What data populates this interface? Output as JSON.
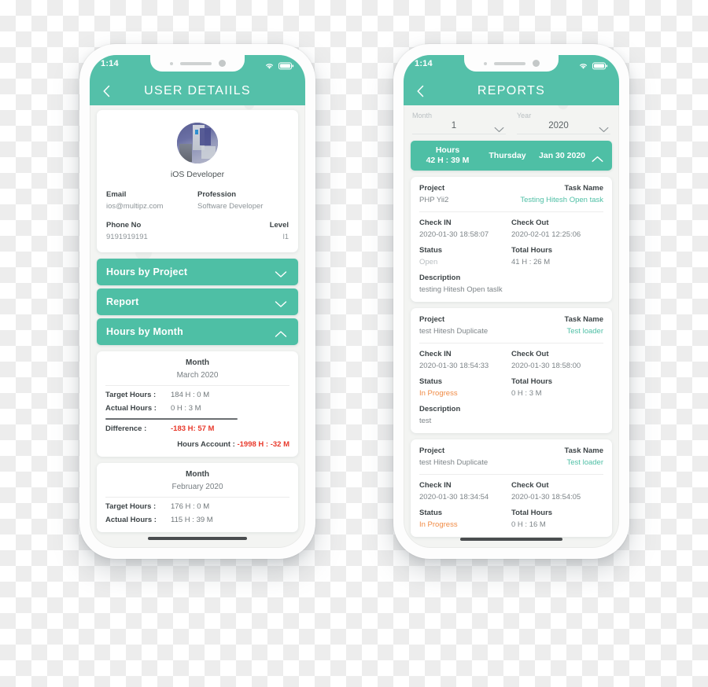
{
  "phones": [
    {
      "status_bar": {
        "time": "1:14",
        "wifi_icon": "wifi-icon",
        "battery_icon": "battery-icon"
      },
      "header": {
        "back_icon": "chevron-left-icon",
        "title": "USER DETAIILS"
      },
      "profile": {
        "avatar_alt": "user-avatar",
        "name": "iOS Developer",
        "fields": [
          {
            "label": "Email",
            "value": "ios@multipz.com"
          },
          {
            "label": "Profession",
            "value": "Software Developer"
          },
          {
            "label": "Phone No",
            "value": "9191919191"
          },
          {
            "label": "Level",
            "value": "l1"
          }
        ]
      },
      "accordions": [
        {
          "label": "Hours by Project",
          "icon": "chevron-down-icon",
          "expanded": false
        },
        {
          "label": "Report",
          "icon": "chevron-down-icon",
          "expanded": false
        },
        {
          "label": "Hours by Month",
          "icon": "chevron-up-icon",
          "expanded": true
        }
      ],
      "months": [
        {
          "head": "Month",
          "name": "March 2020",
          "target_label": "Target Hours :",
          "target_value": "184 H : 0 M",
          "actual_label": "Actual Hours :",
          "actual_value": "0 H : 3 M",
          "difference_label": "Difference :",
          "difference_value": "-183 H: 57 M",
          "account_label": "Hours Account :",
          "account_value": "-1998 H : -32 M"
        },
        {
          "head": "Month",
          "name": "February 2020",
          "target_label": "Target Hours :",
          "target_value": "176 H : 0 M",
          "actual_label": "Actual Hours :",
          "actual_value": "115 H : 39 M"
        }
      ]
    },
    {
      "status_bar": {
        "time": "1:14",
        "wifi_icon": "wifi-icon",
        "battery_icon": "battery-icon"
      },
      "header": {
        "back_icon": "chevron-left-icon",
        "title": "REPORTS"
      },
      "selectors": [
        {
          "label": "Month",
          "value": "1",
          "icon": "chevron-down-icon"
        },
        {
          "label": "Year",
          "value": "2020",
          "icon": "chevron-down-icon"
        }
      ],
      "day_bar": {
        "hours_label": "Hours",
        "hours_value": "42 H : 39 M",
        "weekday": "Thursday",
        "date": "Jan 30  2020",
        "icon": "chevron-up-icon"
      },
      "report_labels": {
        "project": "Project",
        "task_name": "Task Name",
        "check_in": "Check IN",
        "check_out": "Check Out",
        "status": "Status",
        "total_hours": "Total Hours",
        "description": "Description"
      },
      "reports": [
        {
          "project": "PHP Yii2",
          "task_name": "Testing Hitesh Open task",
          "check_in": "2020-01-30 18:58:07",
          "check_out": "2020-02-01 12:25:06",
          "status": "Open",
          "status_type": "open",
          "total_hours": "41 H : 26 M",
          "description": "testing Hitesh Open taslk"
        },
        {
          "project": "test Hitesh Duplicate",
          "task_name": "Test loader",
          "check_in": "2020-01-30 18:54:33",
          "check_out": "2020-01-30 18:58:00",
          "status": "In Progress",
          "status_type": "progress",
          "total_hours": "0 H : 3 M",
          "description": "test"
        },
        {
          "project": "test Hitesh Duplicate",
          "task_name": "Test loader",
          "check_in": "2020-01-30 18:34:54",
          "check_out": "2020-01-30 18:54:05",
          "status": "In Progress",
          "status_type": "progress",
          "total_hours": "0 H : 16 M",
          "description": ""
        }
      ]
    }
  ],
  "colors": {
    "teal": "#4ebfa5",
    "teal_header": "#54c0a9",
    "red": "#e8392b",
    "orange": "#f08b45",
    "muted": "#8d9498"
  }
}
